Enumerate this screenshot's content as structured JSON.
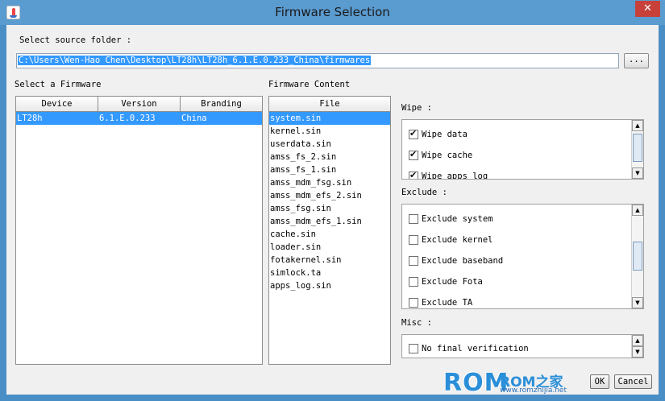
{
  "window": {
    "title": "Firmware Selection",
    "close_label": "✕"
  },
  "source": {
    "label": "Select source folder :",
    "path": "C:\\Users\\Wen-Hao Chen\\Desktop\\LT28h\\LT28h_6.1.E.0.233_China\\firmwares",
    "browse_label": "..."
  },
  "firmware_list": {
    "label": "Select a Firmware",
    "columns": [
      "Device",
      "Version",
      "Branding"
    ],
    "rows": [
      {
        "device": "LT28h",
        "version": "6.1.E.0.233",
        "branding": "China"
      }
    ]
  },
  "content": {
    "label": "Firmware Content",
    "column": "File",
    "files": [
      "system.sin",
      "kernel.sin",
      "userdata.sin",
      "amss_fs_2.sin",
      "amss_fs_1.sin",
      "amss_mdm_fsg.sin",
      "amss_mdm_efs_2.sin",
      "amss_fsg.sin",
      "amss_mdm_efs_1.sin",
      "cache.sin",
      "loader.sin",
      "fotakernel.sin",
      "simlock.ta",
      "apps_log.sin"
    ]
  },
  "wipe": {
    "label": "Wipe :",
    "items": [
      {
        "label": "Wipe data",
        "checked": true
      },
      {
        "label": "Wipe cache",
        "checked": true
      },
      {
        "label": "Wipe apps log",
        "checked": true
      }
    ]
  },
  "exclude": {
    "label": "Exclude :",
    "items": [
      {
        "label": "Exclude system",
        "checked": false
      },
      {
        "label": "Exclude kernel",
        "checked": false
      },
      {
        "label": "Exclude baseband",
        "checked": false
      },
      {
        "label": "Exclude Fota",
        "checked": false
      },
      {
        "label": "Exclude TA",
        "checked": false
      }
    ]
  },
  "misc": {
    "label": "Misc :",
    "items": [
      {
        "label": "No final verification",
        "checked": false
      }
    ]
  },
  "buttons": {
    "ok": "OK",
    "cancel": "Cancel"
  },
  "watermark": {
    "big": "ROM",
    "small": "ROM之家",
    "url": "www.romzhijia.net"
  }
}
